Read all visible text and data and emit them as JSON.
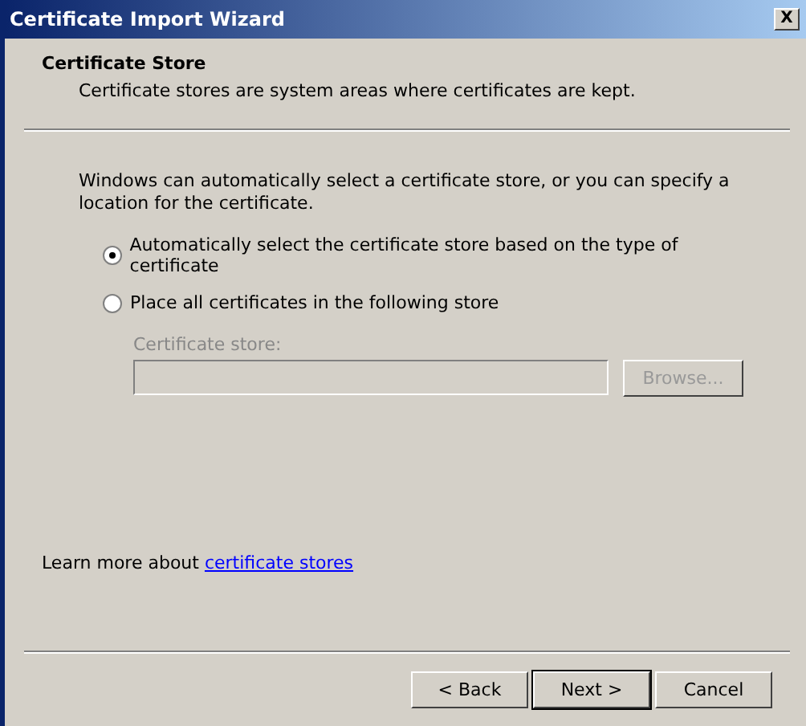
{
  "window": {
    "title": "Certificate Import Wizard",
    "close_label": "X"
  },
  "header": {
    "title": "Certificate Store",
    "subtitle": "Certificate stores are system areas where certificates are kept."
  },
  "intro": "Windows can automatically select a certificate store, or you can specify a location for the certificate.",
  "options": [
    {
      "label": "Automatically select the certificate store based on the type of certificate",
      "selected": true
    },
    {
      "label": "Place all certificates in the following store",
      "selected": false
    }
  ],
  "store": {
    "label": "Certificate store:",
    "disabled": true,
    "browse": "Browse..."
  },
  "learn_more": {
    "text": "Learn more about ",
    "link": "certificate stores"
  },
  "buttons": [
    {
      "label": "< Back",
      "default": false
    },
    {
      "label": "Next >",
      "default": true
    },
    {
      "label": "Cancel",
      "default": false
    }
  ]
}
